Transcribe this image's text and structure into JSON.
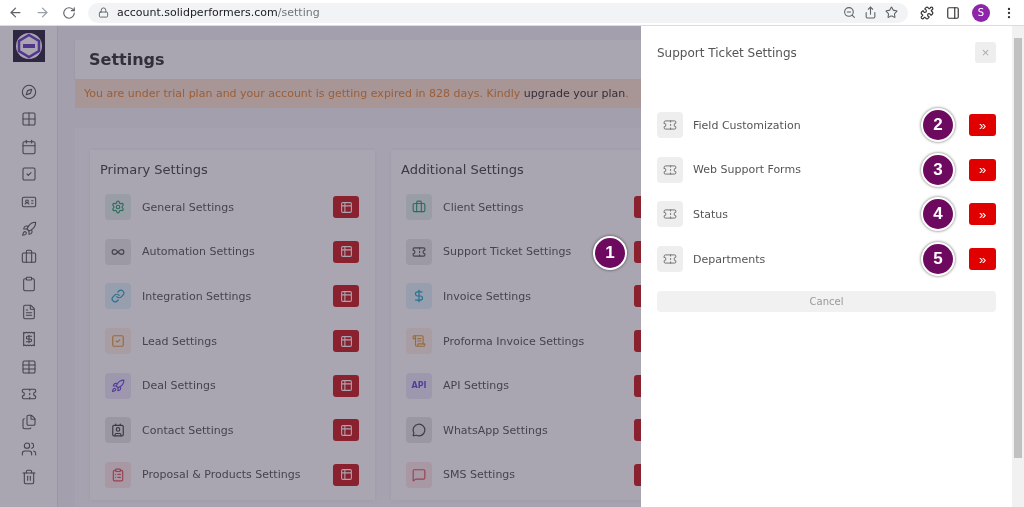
{
  "browser": {
    "url_host": "account.solidperformers.com",
    "url_path": "/setting",
    "profile_initial": "S"
  },
  "page": {
    "title": "Settings",
    "banner": {
      "text": "You are under trial plan and your account is getting expired in 828 days. Kindly",
      "link": "upgrade your plan",
      "end": "."
    }
  },
  "sections": [
    {
      "title": "Primary Settings",
      "items": [
        {
          "label": "General Settings"
        },
        {
          "label": "Automation Settings"
        },
        {
          "label": "Integration Settings"
        },
        {
          "label": "Lead Settings"
        },
        {
          "label": "Deal Settings"
        },
        {
          "label": "Contact Settings"
        },
        {
          "label": "Proposal & Products Settings"
        }
      ]
    },
    {
      "title": "Additional Settings",
      "items": [
        {
          "label": "Client Settings"
        },
        {
          "label": "Support Ticket Settings",
          "callout": "1"
        },
        {
          "label": "Invoice Settings"
        },
        {
          "label": "Proforma Invoice Settings"
        },
        {
          "label": "API Settings",
          "icon_text": "API"
        },
        {
          "label": "WhatsApp Settings"
        },
        {
          "label": "SMS Settings"
        }
      ]
    }
  ],
  "drawer": {
    "title": "Support Ticket Settings",
    "close": "×",
    "items": [
      {
        "label": "Field Customization",
        "callout": "2",
        "action": "»"
      },
      {
        "label": "Web Support Forms",
        "callout": "3",
        "action": "»"
      },
      {
        "label": "Status",
        "callout": "4",
        "action": "»"
      },
      {
        "label": "Departments",
        "callout": "5",
        "action": "»"
      }
    ],
    "cancel": "Cancel"
  }
}
